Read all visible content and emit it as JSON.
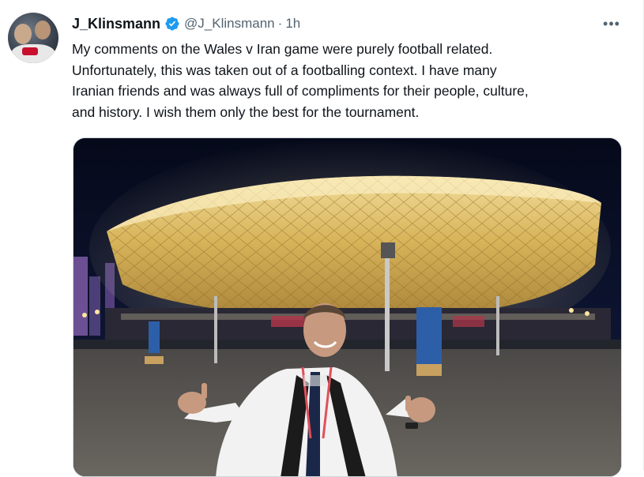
{
  "tweet": {
    "display_name": "J_Klinsmann",
    "handle": "@J_Klinsmann",
    "separator": "·",
    "time": "1h",
    "text": "My comments on the Wales v Iran game were purely football related.\nUnfortunately, this was taken out of a footballing context. I have many\nIranian friends and was always full of compliments for their people, culture,\nand history. I wish them only the best for the tournament.",
    "more_label": "•••"
  },
  "colors": {
    "verified": "#1d9bf0",
    "text": "#0f1419",
    "secondary": "#536471"
  },
  "icons": {
    "verified": "verified-badge-icon",
    "more": "more-options-icon"
  }
}
